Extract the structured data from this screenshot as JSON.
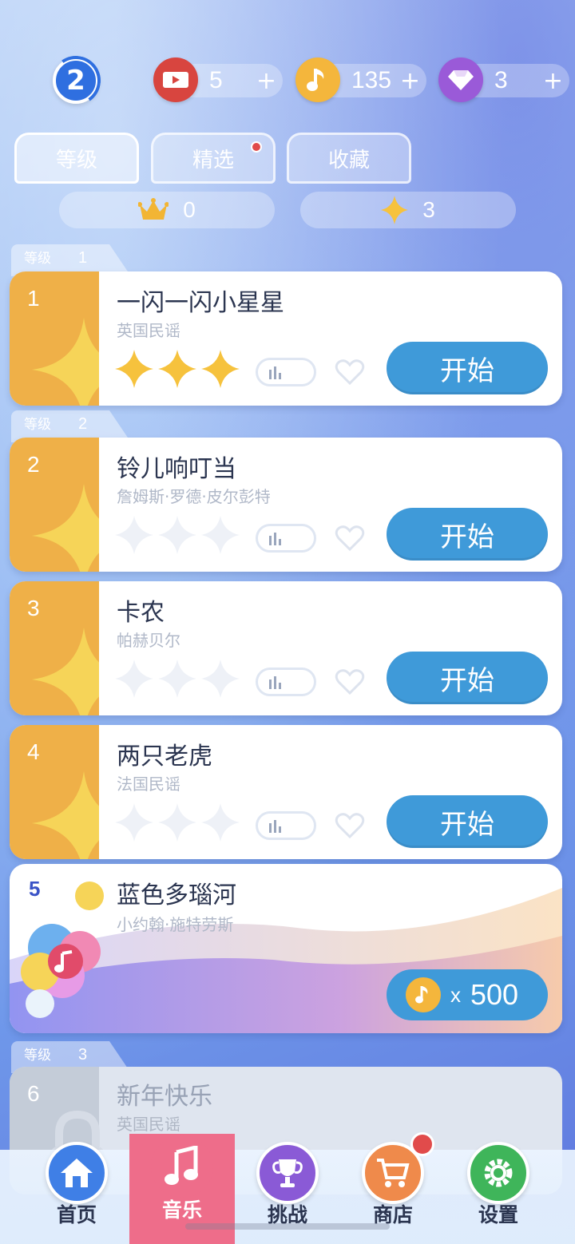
{
  "header": {
    "player_level": "2",
    "currencies": [
      {
        "icon": "ticket-icon",
        "amount": "5",
        "plus": "+"
      },
      {
        "icon": "music-note-icon",
        "amount": "135",
        "plus": "+"
      },
      {
        "icon": "diamond-icon",
        "amount": "3",
        "plus": "+"
      }
    ]
  },
  "tabs": [
    {
      "label": "等级",
      "active": true
    },
    {
      "label": "精选",
      "has_dot": true
    },
    {
      "label": "收藏"
    }
  ],
  "stats": {
    "crowns": "0",
    "stars": "3"
  },
  "groups": [
    {
      "label": "等级",
      "number": "1"
    },
    {
      "label": "等级",
      "number": "2"
    },
    {
      "label": "等级",
      "number": "3"
    }
  ],
  "songs": [
    {
      "number": "1",
      "title": "一闪一闪小星星",
      "artist": "英国民谣",
      "stars_earned": 3,
      "start_label": "开始"
    },
    {
      "number": "2",
      "title": "铃儿响叮当",
      "artist": "詹姆斯·罗德·皮尔彭特",
      "stars_earned": 0,
      "start_label": "开始"
    },
    {
      "number": "3",
      "title": "卡农",
      "artist": "帕赫贝尔",
      "stars_earned": 0,
      "start_label": "开始"
    },
    {
      "number": "4",
      "title": "两只老虎",
      "artist": "法国民谣",
      "stars_earned": 0,
      "start_label": "开始"
    }
  ],
  "special_song": {
    "number": "5",
    "title": "蓝色多瑙河",
    "artist": "小约翰·施特劳斯",
    "price_x": "x",
    "price": "500"
  },
  "locked_song": {
    "number": "6",
    "title": "新年快乐",
    "artist": "英国民谣"
  },
  "nav": [
    {
      "label": "首页",
      "icon": "home-icon"
    },
    {
      "label": "音乐",
      "icon": "music-note-icon",
      "active": true
    },
    {
      "label": "挑战",
      "icon": "trophy-icon"
    },
    {
      "label": "商店",
      "icon": "cart-icon",
      "badge": true
    },
    {
      "label": "设置",
      "icon": "gear-icon"
    }
  ],
  "colors": {
    "accent_blue": "#3f9ad9",
    "gold": "#efb048",
    "active_nav": "#ee6d8a",
    "badge_red": "#e14b4b"
  }
}
